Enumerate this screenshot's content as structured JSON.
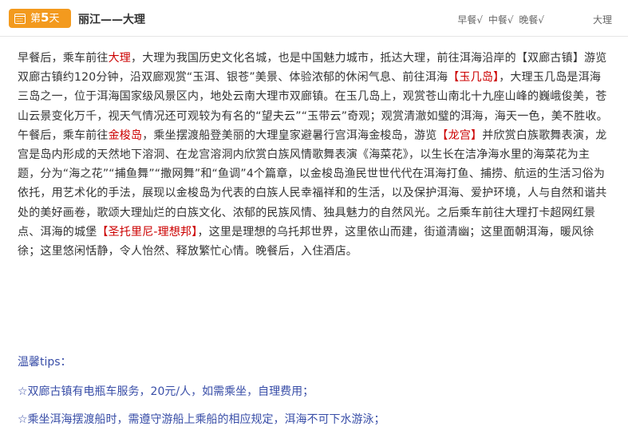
{
  "header": {
    "day_prefix": "第",
    "day_number": "5",
    "day_suffix": "天",
    "route": "丽江——大理",
    "meals": [
      "早餐√",
      "中餐√",
      "晚餐√"
    ],
    "accommodation": "大理",
    "badge_color": "#f39a1e"
  },
  "itinerary": {
    "segments": [
      {
        "text": "早餐后，乘车前往",
        "hl": false
      },
      {
        "text": "大理",
        "hl": true
      },
      {
        "text": "，大理为我国历史文化名城，也是中国魅力城市，抵达大理，前往洱海沿岸的【双廊古镇】游览双廊古镇约120分钟，沿双廊观赏“玉洱、银苍”美景、体验浓郁的休闲气息、前往洱海",
        "hl": false
      },
      {
        "text": "【玉几岛】",
        "hl": true
      },
      {
        "text": "，大理玉几岛是洱海三岛之一，位于洱海国家级风景区内，地处云南大理市双廊镇。在玉几岛上，观赏苍山南北十九座山峰的巍峨俊美，苍山云景变化万千，视天气情况还可观较为有名的“望夫云”“玉带云”奇观；观赏清澈如璧的洱海，海天一色，美不胜收。午餐后，乘车前往",
        "hl": false
      },
      {
        "text": "金梭岛",
        "hl": true
      },
      {
        "text": "，乘坐摆渡船登美丽的大理皇家避暑行宫洱海金梭岛，游览",
        "hl": false
      },
      {
        "text": "【龙宫】",
        "hl": true
      },
      {
        "text": "并欣赏白族歌舞表演，龙宫是岛内形成的天然地下溶洞、在龙宫溶洞内欣赏白族风情歌舞表演《海菜花》，以生长在洁净海水里的海菜花为主题，分为“海之花”“捕鱼舞”“撒网舞”和“鱼调”4个篇章，以金梭岛渔民世世代代在洱海打鱼、捕捞、航运的生活习俗为依托，用艺术化的手法，展现以金梭岛为代表的白族人民幸福祥和的生活，以及保护洱海、爱护环境，人与自然和谐共处的美好画卷，歌颂大理灿烂的白族文化、浓郁的民族风情、独具魅力的自然风光。之后乘车前往大理打卡超网红景点、洱海的城堡",
        "hl": false
      },
      {
        "text": "【圣托里尼-理想邦】",
        "hl": true
      },
      {
        "text": "，这里是理想的乌托邦世界，这里依山而建，街道清幽；这里面朝洱海，暖风徐徐；这里悠闲恬静，令人怡然、释放繁忙心情。晚餐后，入住酒店。",
        "hl": false
      }
    ],
    "highlight_color": "#cc0000"
  },
  "tips": {
    "title": "温馨tips：",
    "items": [
      "☆双廊古镇有电瓶车服务，20元/人，如需乘坐，自理费用；",
      "☆乘坐洱海摆渡船时，需遵守游船上乘船的相应规定，洱海不可下水游泳；"
    ],
    "color": "#3a4fa8"
  }
}
